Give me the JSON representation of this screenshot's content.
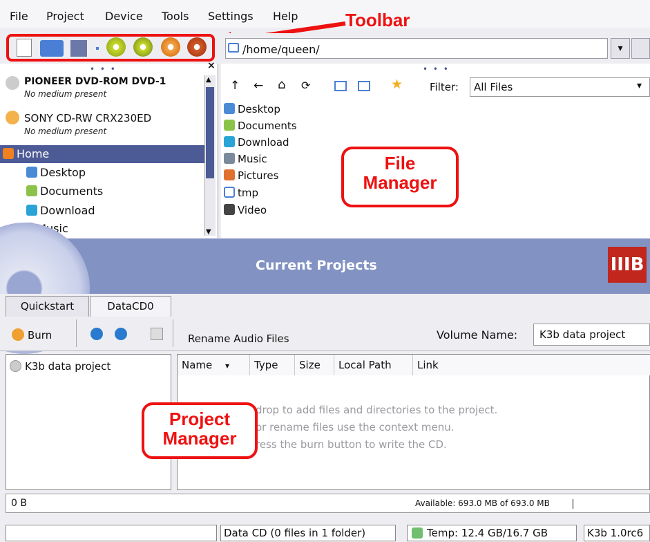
{
  "menu": {
    "file": "File",
    "project": "Project",
    "device": "Device",
    "tools": "Tools",
    "settings": "Settings",
    "help": "Help"
  },
  "annotations": {
    "toolbar": "Toolbar",
    "file_manager": "File\nManager",
    "project_manager": "Project\nManager"
  },
  "toolbar": {
    "path_value": "/home/queen/"
  },
  "devices": [
    {
      "title": "PIONEER DVD-ROM DVD-1",
      "subtitle": "No medium present"
    },
    {
      "title": "SONY CD-RW  CRX230ED",
      "subtitle": "No medium present"
    }
  ],
  "tree": {
    "home": "Home",
    "items": [
      "Desktop",
      "Documents",
      "Download",
      "Music"
    ]
  },
  "filemanager": {
    "filter_label": "Filter:",
    "filter_value": "All Files",
    "files": [
      "Desktop",
      "Documents",
      "Download",
      "Music",
      "Pictures",
      "tmp",
      "Video"
    ]
  },
  "project": {
    "title": "Current Projects",
    "logo": "IIIB",
    "tabs": [
      "Quickstart",
      "DataCD0"
    ],
    "burn_label": "Burn",
    "rename_audio": "Rename Audio Files",
    "volume_label": "Volume Name:",
    "volume_value": "K3b data project",
    "tree_root": "K3b data project",
    "columns": [
      "Name",
      "Type",
      "Size",
      "Local Path",
      "Link"
    ],
    "empty_lines": [
      "drop to add files and directories to the project.",
      "or rename files use the context menu.",
      "ress the burn button to write the CD."
    ],
    "size": "0 B",
    "available": "Available: 693.0 MB of 693.0 MB"
  },
  "status": {
    "data_cd": "Data CD (0 files in 1 folder)",
    "temp": "Temp: 12.4 GB/16.7 GB",
    "version": "K3b 1.0rc6"
  },
  "colors": {
    "accent": "#4c5a96",
    "header": "#8292c2",
    "callout": "#ee1111"
  }
}
